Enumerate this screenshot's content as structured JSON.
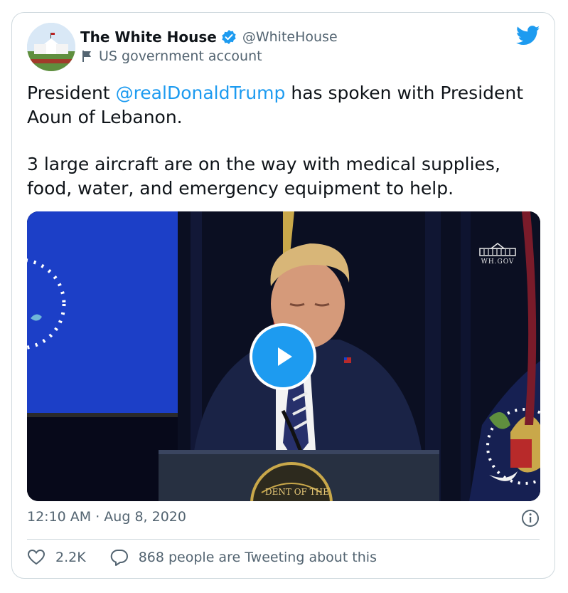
{
  "author": {
    "name": "The White House",
    "handle": "@WhiteHouse",
    "account_label": "US government account"
  },
  "tweet": {
    "text_part1_prefix": "President ",
    "mention": "@realDonaldTrump",
    "text_part1_suffix": " has spoken with President Aoun of Lebanon.",
    "text_part2": "3 large aircraft are on the way with medical supplies, food, water, and emergency equipment to help."
  },
  "media": {
    "watermark": "WH.GOV",
    "seal_text": "DENT OF THE"
  },
  "meta": {
    "timestamp": "12:10 AM · Aug 8, 2020"
  },
  "actions": {
    "likes": "2.2K",
    "conversation": "868 people are Tweeting about this"
  },
  "colors": {
    "accent": "#1d9bf0",
    "text": "#0f1419",
    "secondary": "#536471",
    "border": "#cfd9de"
  },
  "icons": [
    "white-house-avatar",
    "verified-badge-icon",
    "government-flag-icon",
    "twitter-bird-icon",
    "play-icon",
    "info-icon",
    "heart-icon",
    "reply-bubble-icon"
  ]
}
